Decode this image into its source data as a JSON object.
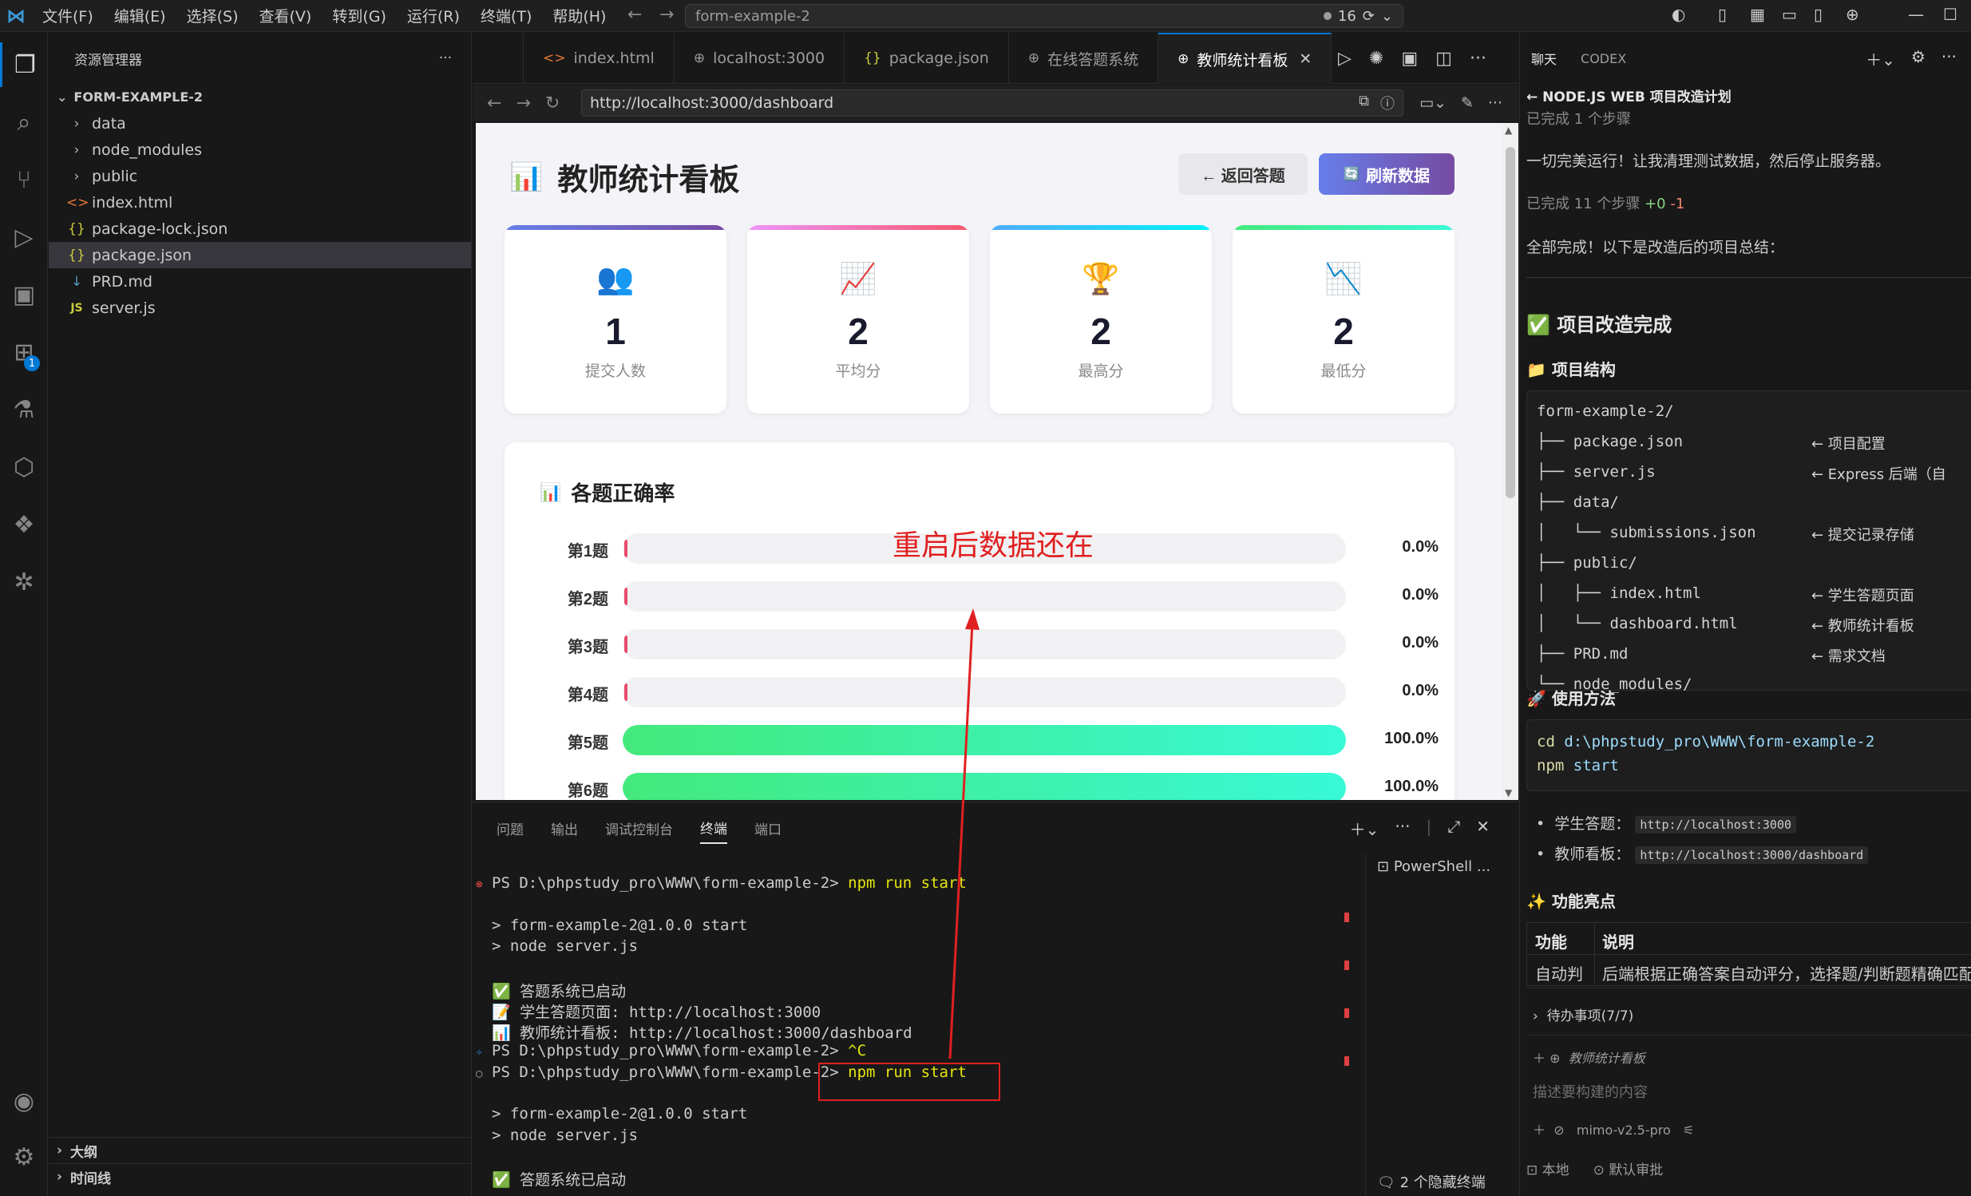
{
  "titlebar": {
    "menus": [
      "文件(F)",
      "编辑(E)",
      "选择(S)",
      "查看(V)",
      "转到(G)",
      "运行(R)",
      "终端(T)",
      "帮助(H)"
    ],
    "search": "form-example-2",
    "badge_count": "16"
  },
  "explorer": {
    "title": "资源管理器",
    "root": "FORM-EXAMPLE-2",
    "items": [
      {
        "name": "data",
        "kind": "folder"
      },
      {
        "name": "node_modules",
        "kind": "folder"
      },
      {
        "name": "public",
        "kind": "folder"
      },
      {
        "name": "index.html",
        "kind": "html"
      },
      {
        "name": "package-lock.json",
        "kind": "json"
      },
      {
        "name": "package.json",
        "kind": "json"
      },
      {
        "name": "PRD.md",
        "kind": "md"
      },
      {
        "name": "server.js",
        "kind": "js"
      }
    ],
    "outline": "大纲",
    "timeline": "时间线"
  },
  "tabs": [
    {
      "label": "index.html",
      "icon": "<>"
    },
    {
      "label": "localhost:3000",
      "icon": "globe"
    },
    {
      "label": "package.json",
      "icon": "{}"
    },
    {
      "label": "在线答题系统",
      "icon": "globe"
    },
    {
      "label": "教师统计看板",
      "icon": "globe"
    }
  ],
  "browser": {
    "url": "http://localhost:3000/dashboard"
  },
  "dashboard": {
    "title": "教师统计看板",
    "back_button": "← 返回答题",
    "refresh_button": "刷新数据",
    "stats": [
      {
        "value": "1",
        "label": "提交人数",
        "icon": "users-icon",
        "color": "#667eea"
      },
      {
        "value": "2",
        "label": "平均分",
        "icon": "chart-up-icon",
        "color": "#f093fb"
      },
      {
        "value": "2",
        "label": "最高分",
        "icon": "trophy-icon",
        "color": "#4facfe"
      },
      {
        "value": "2",
        "label": "最低分",
        "icon": "chart-down-icon",
        "color": "#43e97b"
      }
    ],
    "rate_title": "各题正确率",
    "rates": [
      {
        "label": "第1题",
        "pct": "0.0%",
        "value": 0
      },
      {
        "label": "第2题",
        "pct": "0.0%",
        "value": 0
      },
      {
        "label": "第3题",
        "pct": "0.0%",
        "value": 0
      },
      {
        "label": "第4题",
        "pct": "0.0%",
        "value": 0
      },
      {
        "label": "第5题",
        "pct": "100.0%",
        "value": 100
      },
      {
        "label": "第6题",
        "pct": "100.0%",
        "value": 100
      }
    ]
  },
  "annotation": "重启后数据还在",
  "panel": {
    "tabs": [
      "问题",
      "输出",
      "调试控制台",
      "终端",
      "端口"
    ],
    "active_tab": "终端",
    "terminal_lines": [
      {
        "prompt": "PS D:\\phpstudy_pro\\WWW\\form-example-2> ",
        "cmd": "npm run start",
        "mark": "error"
      },
      {
        "text": ""
      },
      {
        "text": "> form-example-2@1.0.0 start"
      },
      {
        "text": "> node server.js"
      },
      {
        "text": ""
      },
      {
        "text": "✅ 答题系统已启动"
      },
      {
        "text": "📝 学生答题页面: http://localhost:3000"
      },
      {
        "text": "📊 教师统计看板: http://localhost:3000/dashboard"
      },
      {
        "prompt": "PS D:\\phpstudy_pro\\WWW\\form-example-2> ",
        "cmd": "^C",
        "mark": "spark"
      },
      {
        "prompt": "PS D:\\phpstudy_pro\\WWW\\form-example-2> ",
        "cmd": "npm run start",
        "mark": "circle"
      },
      {
        "text": ""
      },
      {
        "text": "> form-example-2@1.0.0 start"
      },
      {
        "text": "> node server.js"
      },
      {
        "text": ""
      },
      {
        "text": "✅ 答题系统已启动"
      }
    ],
    "terminal_name": "PowerShell ...",
    "hidden_terminals": "2 个隐藏终端"
  },
  "chat": {
    "tabs": [
      "聊天",
      "CODEX"
    ],
    "plan_title": "NODE.JS WEB 项目改造计划",
    "done1": "已完成 1 个步骤",
    "msg1": "一切完美运行！让我清理测试数据，然后停止服务器。",
    "done2": "已完成 11 个步骤",
    "diff_add": "+0",
    "diff_del": "-1",
    "msg2": "全部完成！以下是改造后的项目总结：",
    "h_done": "✅ 项目改造完成",
    "h_struct": "📁 项目结构",
    "tree": [
      {
        "line": "form-example-2/",
        "comment": ""
      },
      {
        "line": "├── package.json",
        "comment": "← 项目配置"
      },
      {
        "line": "├── server.js",
        "comment": "← Express 后端（自"
      },
      {
        "line": "├── data/",
        "comment": ""
      },
      {
        "line": "│   └── submissions.json",
        "comment": "← 提交记录存储"
      },
      {
        "line": "├── public/",
        "comment": ""
      },
      {
        "line": "│   ├── index.html",
        "comment": "← 学生答题页面"
      },
      {
        "line": "│   └── dashboard.html",
        "comment": "← 教师统计看板"
      },
      {
        "line": "├── PRD.md",
        "comment": "← 需求文档"
      },
      {
        "line": "└── node_modules/",
        "comment": ""
      }
    ],
    "h_usage": "🚀 使用方法",
    "usage_cd": "cd",
    "usage_path": "d:\\phpstudy_pro\\WWW\\form-example-2",
    "usage_npm": "npm",
    "usage_start": "start",
    "bullets": [
      {
        "label": "学生答题：",
        "code": "http://localhost:3000"
      },
      {
        "label": "教师看板：",
        "code": "http://localhost:3000/dashboard"
      }
    ],
    "h_feat": "✨ 功能亮点",
    "table_head": [
      "功能",
      "说明"
    ],
    "table_row": [
      "自动判",
      "后端根据正确答案自动评分，选择题/判断题精确匹配，"
    ],
    "todo": "待办事项(7/7)",
    "context_chip": "教师统计看板",
    "input_placeholder": "描述要构建的内容",
    "model": "mimo-v2.5-pro",
    "status_local": "本地",
    "status_approve": "默认审批"
  }
}
